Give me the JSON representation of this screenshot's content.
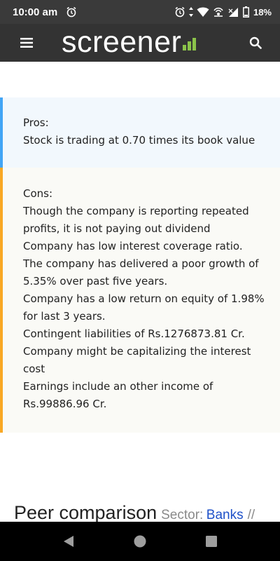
{
  "status_bar": {
    "time": "10:00 am",
    "battery": "18%",
    "icons": [
      "alarm-icon",
      "alarm-icon",
      "data-arrows-icon",
      "wifi-icon",
      "hotspot-icon",
      "signal-icon",
      "battery-icon"
    ]
  },
  "app_bar": {
    "logo_text": "screener",
    "logo_accent_color": "#8bc34a",
    "menu_icon": "hamburger-menu-icon",
    "search_icon": "search-icon"
  },
  "pros": {
    "title": "Pros:",
    "accent_color": "#42a5f5",
    "items": [
      "Stock is trading at 0.70 times its book value"
    ]
  },
  "cons": {
    "title": "Cons:",
    "accent_color": "#f9a825",
    "items": [
      "Though the company is reporting repeated profits, it is not paying out dividend",
      "Company has low interest coverage ratio.",
      "The company has delivered a poor growth of 5.35% over past five years.",
      "Company has a low return on equity of 1.98% for last 3 years.",
      "Contingent liabilities of Rs.1276873.81 Cr.",
      "Company might be capitalizing the interest cost",
      "Earnings include an other income of Rs.99886.96 Cr."
    ]
  },
  "peer_comparison": {
    "title": "Peer comparison",
    "sector_label": "Sector:",
    "sector_link": "Banks",
    "separator": "//"
  },
  "nav_bar": {
    "icons": [
      "back-icon",
      "home-icon",
      "recent-apps-icon"
    ]
  }
}
